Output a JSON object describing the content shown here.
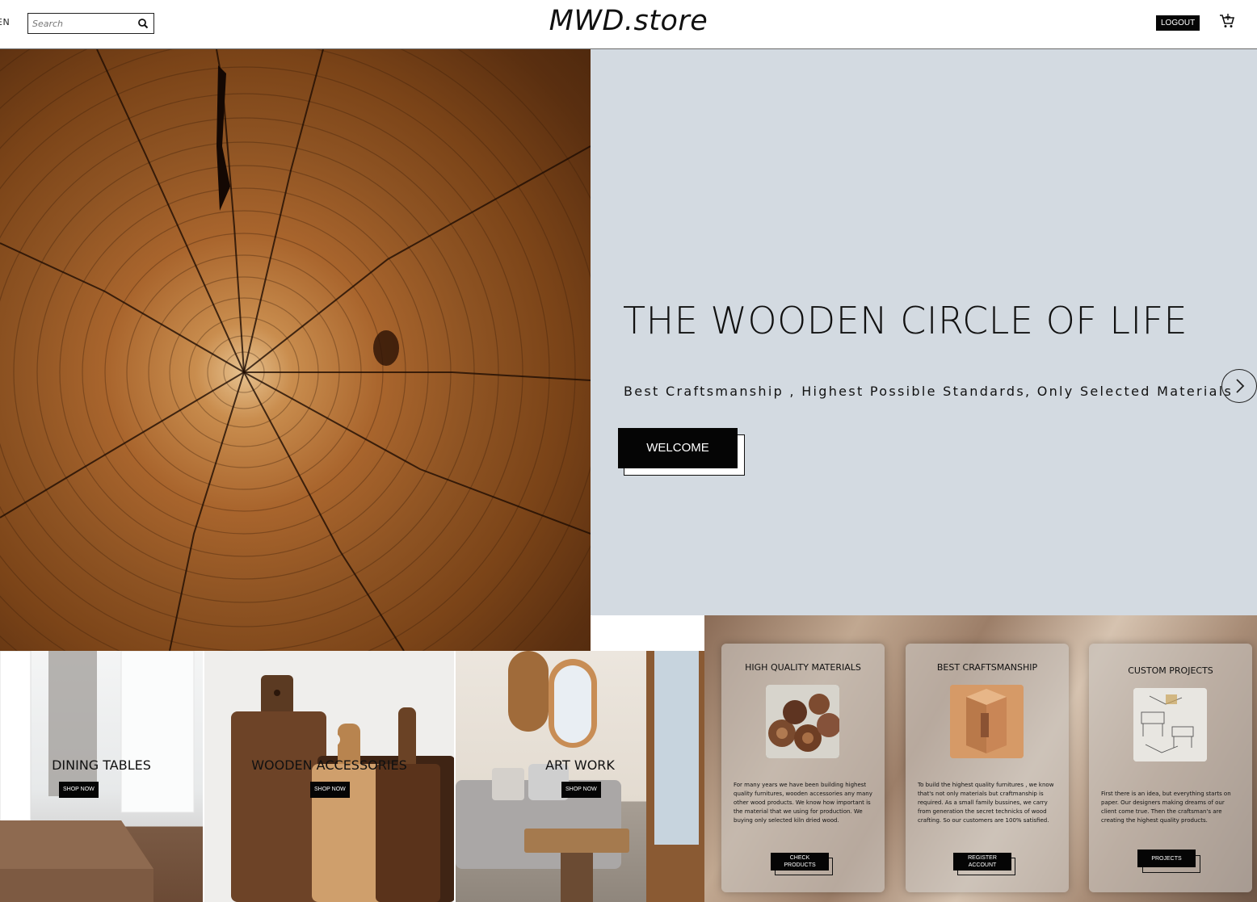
{
  "header": {
    "lang": "EN",
    "search_placeholder": "Search",
    "logo": "MWD.store",
    "logout_label": "LOGOUT"
  },
  "hero": {
    "title": "THE WOODEN CIRCLE OF LIFE",
    "subtitle": "Best Craftsmanship , Highest Possible Standards, Only Selected Materials",
    "cta_label": "WELCOME"
  },
  "categories": [
    {
      "label": "DINING TABLES",
      "button": "SHOP NOW"
    },
    {
      "label": "WOODEN ACCESSORIES",
      "button": "SHOP NOW"
    },
    {
      "label": "ART WORK",
      "button": "SHOP NOW"
    }
  ],
  "features": [
    {
      "title": "HIGH QUALITY MATERIALS",
      "text": "For many years we have been building highest quality furnitures, wooden accessories any many other wood products. We know how important is the material that we using for production. We buying only selected kiln dried wood.",
      "button": "CHECK PRODUCTS"
    },
    {
      "title": "BEST CRAFTSMANSHIP",
      "text": "To build the highest quality furnitures , we know that's not only materials but craftmanship is required. As a small family bussines, we carry from generation the secret technicks of wood crafting. So our customers are 100% satisfied.",
      "button": "REGISTER ACCOUNT"
    },
    {
      "title": "CUSTOM PROJECTS",
      "text": "First there is an idea, but everything starts on paper. Our designers making dreams of our client come true. Then the craftsman's are creating the highest quality products.",
      "button": "PROJECTS"
    }
  ],
  "icons": {
    "search": "search-icon",
    "cart": "cart-icon",
    "next": "chevron-right-icon"
  },
  "colors": {
    "accent": "#050505",
    "hero_panel": "#d3dae1"
  }
}
